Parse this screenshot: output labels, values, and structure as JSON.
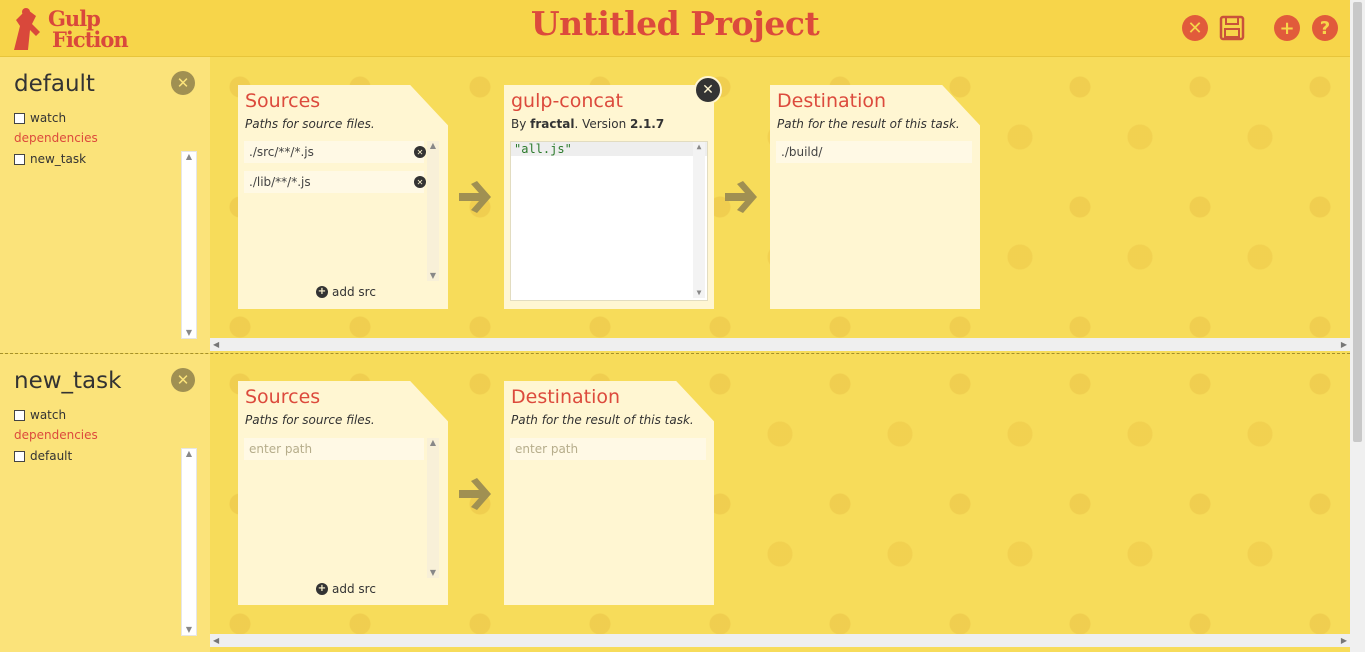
{
  "app": {
    "logo_line1": "Gulp",
    "logo_line2": "Fiction",
    "project_title": "Untitled Project"
  },
  "header_buttons": [
    {
      "name": "close-project",
      "icon": "close-icon"
    },
    {
      "name": "save-project",
      "icon": "save-icon"
    },
    {
      "name": "add-task",
      "icon": "plus-icon"
    },
    {
      "name": "help",
      "icon": "question-icon"
    }
  ],
  "colors": {
    "accent_red": "#dc4a3c",
    "header_yellow": "#f7d54a",
    "panel_yellow": "#fbe37a",
    "card_cream": "#fff6d2",
    "arrow_olive": "#a09052"
  },
  "tasks": [
    {
      "name": "default",
      "watch_label": "watch",
      "dependencies_label": "dependencies",
      "dependencies": [
        {
          "label": "new_task",
          "checked": false
        }
      ],
      "sources": {
        "title": "Sources",
        "subtitle": "Paths for source files.",
        "items": [
          "./src/**/*.js",
          "./lib/**/*.js"
        ],
        "add_label": "add src"
      },
      "plugin": {
        "name": "gulp-concat",
        "by_prefix": "By ",
        "author": "fractal",
        "version_prefix": ". Version ",
        "version": "2.1.7",
        "code": "\"all.js\""
      },
      "destination": {
        "title": "Destination",
        "subtitle": "Path for the result of this task.",
        "value": "./build/"
      }
    },
    {
      "name": "new_task",
      "watch_label": "watch",
      "dependencies_label": "dependencies",
      "dependencies": [
        {
          "label": "default",
          "checked": false
        }
      ],
      "sources": {
        "title": "Sources",
        "subtitle": "Paths for source files.",
        "placeholder": "enter path",
        "add_label": "add src"
      },
      "destination": {
        "title": "Destination",
        "subtitle": "Path for the result of this task.",
        "placeholder": "enter path"
      }
    }
  ]
}
